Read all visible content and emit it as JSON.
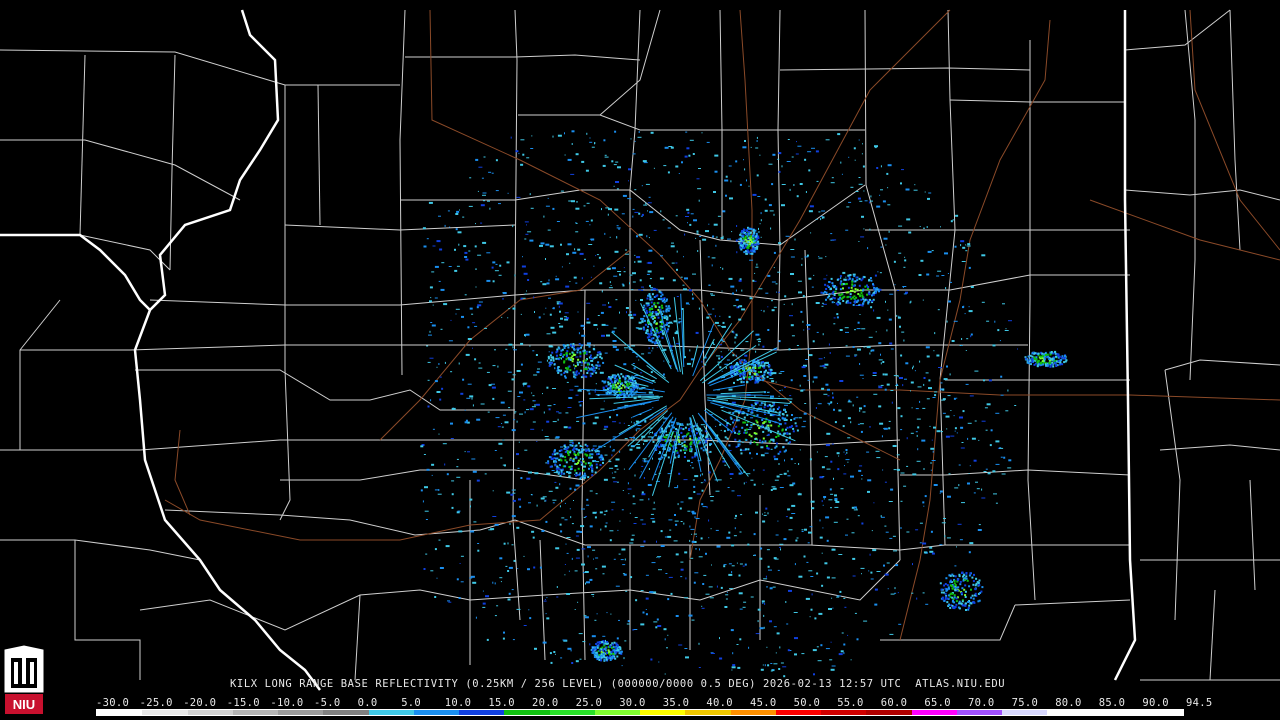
{
  "product": {
    "caption": "KILX LONG RANGE BASE REFLECTIVITY (0.25KM / 256 LEVEL) (000000/0000 0.5 DEG) 2026-02-13 12:57 UTC  ATLAS.NIU.EDU"
  },
  "scale": {
    "ticks": [
      "-30.0",
      "-25.0",
      "-20.0",
      "-15.0",
      "-10.0",
      "-5.0",
      "0.0",
      "5.0",
      "10.0",
      "15.0",
      "20.0",
      "25.0",
      "30.0",
      "35.0",
      "40.0",
      "45.0",
      "50.0",
      "55.0",
      "60.0",
      "65.0",
      "70.0",
      "75.0",
      "80.0",
      "85.0",
      "90.0",
      "94.5"
    ],
    "colors": [
      "#ffffff",
      "#e6e6e6",
      "#cfcfcf",
      "#b4b4b4",
      "#9a9a9a",
      "#808080",
      "#3fc9e6",
      "#1a8ff0",
      "#1040e0",
      "#10c010",
      "#28e028",
      "#80ff30",
      "#ffff00",
      "#f0c800",
      "#ff9000",
      "#ff0000",
      "#d00000",
      "#b00000",
      "#ff00ff",
      "#a050ff",
      "#d8d8ff",
      "#ffffff",
      "#ffffff",
      "#ffffff"
    ]
  },
  "logo": {
    "text": "NIU"
  },
  "map_layers": {
    "county_color": "#cfcfcf",
    "state_color": "#ffffff",
    "road_color": "#8b4a28",
    "echo_colors": [
      "#3fc9e6",
      "#1a8ff0",
      "#1040e0",
      "#10c010",
      "#80ff30"
    ]
  }
}
